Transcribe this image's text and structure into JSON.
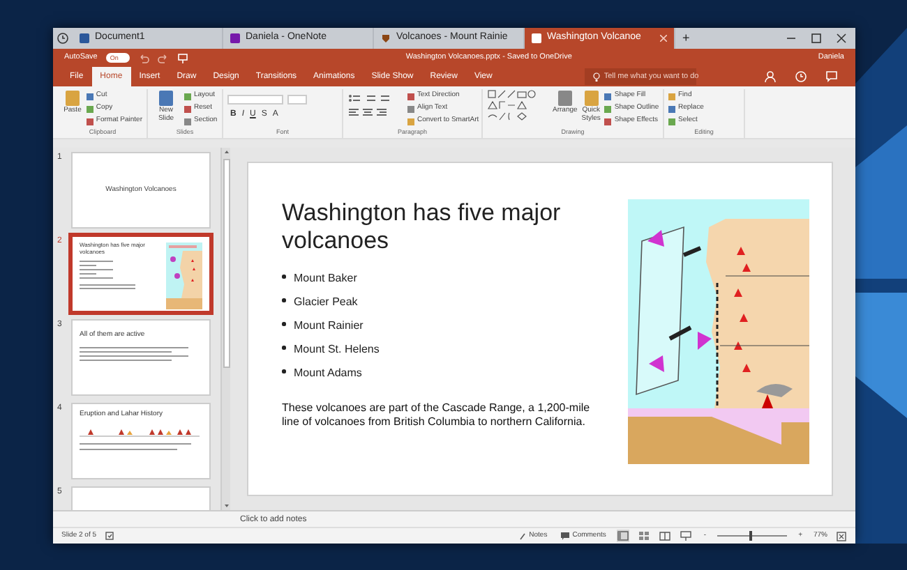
{
  "browser_tabs": [
    {
      "label": "Document1",
      "kind": "word",
      "selected": false
    },
    {
      "label": "Daniela - OneNote",
      "kind": "onenote",
      "selected": false
    },
    {
      "label": "Volcanoes - Mount Rainie",
      "kind": "web",
      "selected": false
    },
    {
      "label": "Washington Volcanoe",
      "kind": "powerpoint",
      "selected": true
    }
  ],
  "new_tab": "+",
  "autosave": {
    "label": "AutoSave",
    "toggle": "On",
    "on": true
  },
  "document_title": "Washington Volcanoes.pptx - Saved to OneDrive",
  "user": "Daniela",
  "ribbon_tabs": [
    {
      "label": "File",
      "selected": false
    },
    {
      "label": "Home",
      "selected": true
    },
    {
      "label": "Insert",
      "selected": false
    },
    {
      "label": "Draw",
      "selected": false
    },
    {
      "label": "Design",
      "selected": false
    },
    {
      "label": "Transitions",
      "selected": false
    },
    {
      "label": "Animations",
      "selected": false
    },
    {
      "label": "Slide Show",
      "selected": false
    },
    {
      "label": "Review",
      "selected": false
    },
    {
      "label": "View",
      "selected": false
    }
  ],
  "tell_me": {
    "placeholder": "Tell me what you want to do"
  },
  "ribbon_groups": [
    {
      "label": "Clipboard",
      "commands": [
        {
          "label": "Paste",
          "kind": "large"
        },
        {
          "label": "Cut",
          "kind": "small"
        },
        {
          "label": "Copy",
          "kind": "small"
        },
        {
          "label": "Format Painter",
          "kind": "small"
        }
      ]
    },
    {
      "label": "Slides",
      "commands": [
        {
          "label": "New Slide",
          "kind": "large"
        },
        {
          "label": "Layout",
          "kind": "small"
        },
        {
          "label": "Reset",
          "kind": "small"
        },
        {
          "label": "Section",
          "kind": "small"
        }
      ]
    },
    {
      "label": "Font",
      "commands": [
        {
          "label": "B",
          "kind": "glyph"
        },
        {
          "label": "I",
          "kind": "glyph"
        },
        {
          "label": "U",
          "kind": "glyph"
        },
        {
          "label": "S",
          "kind": "glyph"
        },
        {
          "label": "A",
          "kind": "glyph"
        }
      ]
    },
    {
      "label": "Paragraph",
      "commands": [
        {
          "label": "Text Direction",
          "kind": "small"
        },
        {
          "label": "Align Text",
          "kind": "small"
        },
        {
          "label": "Convert to SmartArt",
          "kind": "small"
        }
      ]
    },
    {
      "label": "Drawing",
      "commands": [
        {
          "label": "Arrange",
          "kind": "large"
        },
        {
          "label": "Quick Styles",
          "kind": "large"
        },
        {
          "label": "Shape Fill",
          "kind": "small"
        },
        {
          "label": "Shape Outline",
          "kind": "small"
        },
        {
          "label": "Shape Effects",
          "kind": "small"
        }
      ]
    },
    {
      "label": "Editing",
      "commands": [
        {
          "label": "Find",
          "kind": "small"
        },
        {
          "label": "Replace",
          "kind": "small"
        },
        {
          "label": "Select",
          "kind": "small"
        }
      ]
    }
  ],
  "slides": [
    {
      "number": "1",
      "kind": "title",
      "title": "Washington Volcanoes",
      "selected": false
    },
    {
      "number": "2",
      "kind": "picture",
      "title": "Washington has five major volcanoes",
      "selected": true
    },
    {
      "number": "3",
      "kind": "bullets",
      "title": "All of them are active",
      "selected": false
    },
    {
      "number": "4",
      "kind": "timeline",
      "title": "Eruption and Lahar History",
      "selected": false
    },
    {
      "number": "5",
      "kind": "blank",
      "selected": false
    }
  ],
  "slide": {
    "title": "Washington has five major volcanoes",
    "bullets": [
      "Mount Baker",
      "Glacier Peak",
      "Mount Rainier",
      "Mount St. Helens",
      "Mount Adams"
    ],
    "paragraph": "These volcanoes are part of the Cascade Range, a 1,200-mile line of volcanoes from British Columbia to northern California.",
    "image": {
      "kind": "picture"
    }
  },
  "notes": {
    "placeholder": "Click to add notes"
  },
  "status_bar": {
    "slide": "Slide 2 of 5",
    "notes": "Notes",
    "comments": "Comments",
    "zoom_out": "-",
    "zoom_in": "+",
    "zoom_slider": {
      "level": 0.45
    },
    "zoom": "77%"
  }
}
